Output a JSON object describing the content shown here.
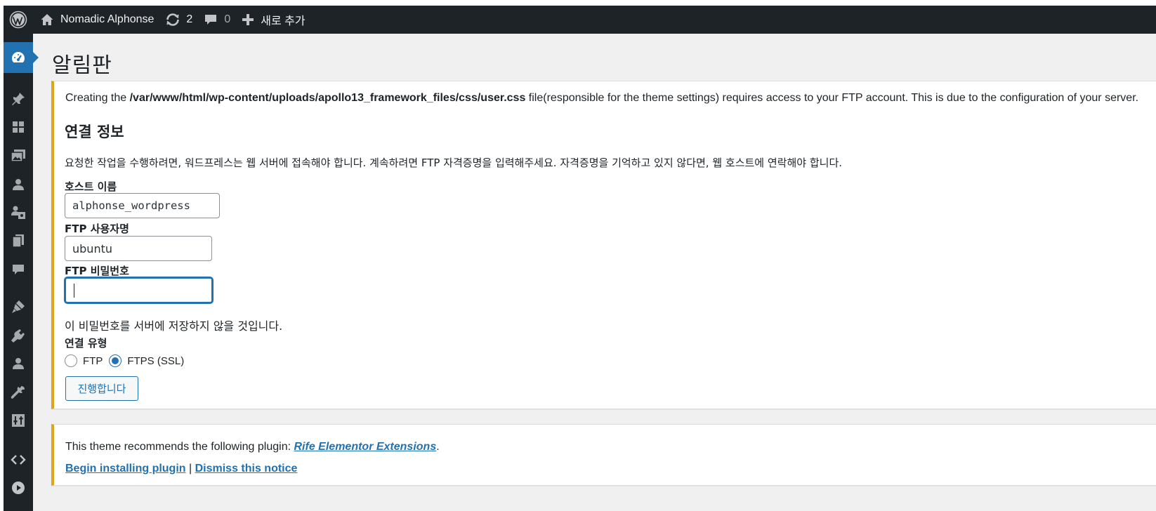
{
  "adminbar": {
    "site_name": "Nomadic Alphonse",
    "updates_count": "2",
    "comments_count": "0",
    "new_label": "새로 추가"
  },
  "sidebar": {
    "items": [
      {
        "icon": "dashboard-icon",
        "current": true
      },
      {
        "icon": "pin-icon"
      },
      {
        "icon": "blocks-icon"
      },
      {
        "icon": "media-icon"
      },
      {
        "icon": "person-icon"
      },
      {
        "icon": "users-media-icon"
      },
      {
        "icon": "pages-icon"
      },
      {
        "icon": "comments-icon"
      },
      {
        "icon": "appearance-icon"
      },
      {
        "icon": "plugins-icon"
      },
      {
        "icon": "users-icon"
      },
      {
        "icon": "tools-icon"
      },
      {
        "icon": "settings-icon"
      },
      {
        "icon": "code-icon"
      },
      {
        "icon": "play-icon"
      }
    ]
  },
  "page": {
    "title": "알림판"
  },
  "ftp_notice": {
    "intro_prefix": "Creating the ",
    "intro_path": "/var/www/html/wp-content/uploads/apollo13_framework_files/css/user.css",
    "intro_suffix": " file(responsible for the theme settings) requires access to your FTP account. This is due to the configuration of your server.",
    "heading": "연결 정보",
    "description": "요청한 작업을 수행하려면, 워드프레스는 웹 서버에 접속해야 합니다. 계속하려면 FTP 자격증명을 입력해주세요. 자격증명을 기억하고 있지 않다면, 웹 호스트에 연락해야 합니다.",
    "host_label": "호스트 이름",
    "host_value": "alphonse_wordpress",
    "username_label": "FTP 사용자명",
    "username_value": "ubuntu",
    "password_label": "FTP 비밀번호",
    "password_value": "",
    "password_hint": "이 비밀번호를 서버에 저장하지 않을 것입니다.",
    "connection_type_label": "연결 유형",
    "option_ftp": "FTP",
    "option_ftps": "FTPS (SSL)",
    "selected_option": "FTPS (SSL)",
    "submit_label": "진행합니다"
  },
  "plugin_notice": {
    "text_prefix": "This theme recommends the following plugin: ",
    "plugin_link": "Rife Elementor Extensions",
    "text_suffix": ".",
    "install_link": "Begin installing plugin",
    "separator": " | ",
    "dismiss_link": "Dismiss this notice"
  },
  "colors": {
    "adminbar_bg": "#1d2327",
    "accent": "#2271b1",
    "notice_border": "#dba617",
    "content_bg": "#f0f0f1"
  }
}
